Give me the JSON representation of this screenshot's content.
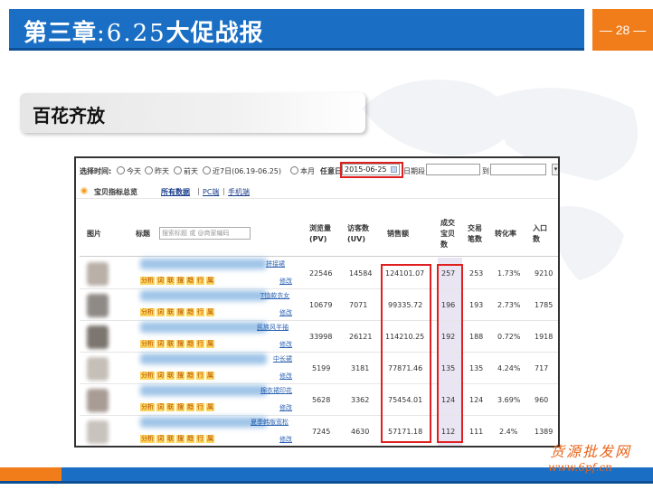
{
  "slide": {
    "title_cn": "第三章",
    "title_sep": ":",
    "title_num": "6.25",
    "title_rest": "大促战报",
    "page_label": "— 28 —",
    "section_tag": "百花齐放",
    "watermark_cn": "货源批发网",
    "watermark_url": "www.6pf.cn"
  },
  "filters": {
    "time_label": "选择时间:",
    "radios": [
      "今天",
      "昨天",
      "前天",
      "近7日(06.19-06.25)",
      "本月"
    ],
    "any_day_label": "任意日",
    "date_value": "2015-06-25",
    "range_label": "日期段",
    "to_label": "到"
  },
  "tabs": {
    "title": "宝贝指标总览",
    "items": [
      "所有数据",
      "PC端",
      "手机端"
    ]
  },
  "table": {
    "headers": {
      "image": "图片",
      "title": "标题",
      "pv": "浏览量(PV)",
      "uv": "访客数(UV)",
      "sales": "销售额",
      "deal_items": "成交宝贝数",
      "deal_count": "交易笔数",
      "conversion": "转化率",
      "entry": "入口数"
    },
    "search_placeholder": "搜索标题 或 @商家编码",
    "action_buttons": [
      "分析",
      "词",
      "联",
      "搜",
      "趋",
      "行",
      "属"
    ],
    "edit_label": "修改",
    "rows": [
      {
        "title_tail": "拼接裙",
        "pv": "22546",
        "uv": "14584",
        "sales": "124101.07",
        "deal_items": "257",
        "deal_count": "253",
        "conversion": "1.73%",
        "entry": "9210"
      },
      {
        "title_tail": "T恤款衣女",
        "pv": "10679",
        "uv": "7071",
        "sales": "99335.72",
        "deal_items": "196",
        "deal_count": "193",
        "conversion": "2.73%",
        "entry": "1785"
      },
      {
        "title_tail": "民族风半袖",
        "pv": "33998",
        "uv": "26121",
        "sales": "114210.25",
        "deal_items": "192",
        "deal_count": "188",
        "conversion": "0.72%",
        "entry": "1918"
      },
      {
        "title_tail": "中长裙",
        "pv": "5199",
        "uv": "3181",
        "sales": "77871.46",
        "deal_items": "135",
        "deal_count": "135",
        "conversion": "4.24%",
        "entry": "717"
      },
      {
        "title_tail": "棉衣裙印花",
        "pv": "5628",
        "uv": "3362",
        "sales": "75454.01",
        "deal_items": "124",
        "deal_count": "124",
        "conversion": "3.69%",
        "entry": "960"
      },
      {
        "title_tail": "夏季韩版宽松",
        "pv": "7245",
        "uv": "4630",
        "sales": "57171.18",
        "deal_items": "112",
        "deal_count": "111",
        "conversion": "2.4%",
        "entry": "1389"
      }
    ]
  }
}
